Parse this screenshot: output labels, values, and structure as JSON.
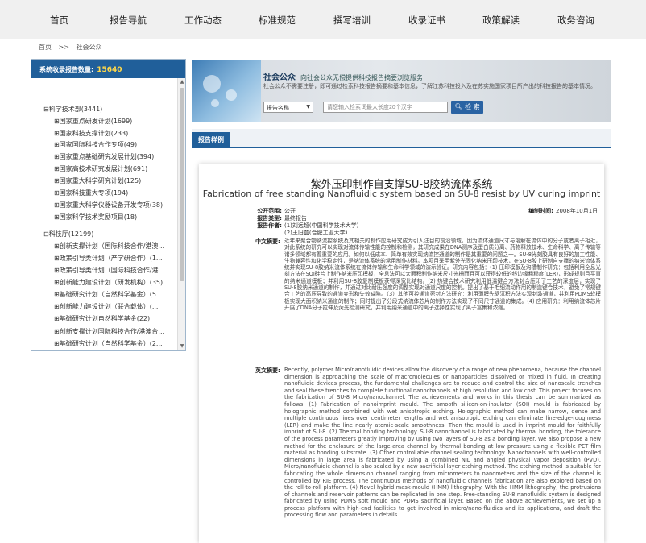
{
  "nav": [
    "首页",
    "报告导航",
    "工作动态",
    "标准规范",
    "撰写培训",
    "收录证书",
    "政策解读",
    "政务咨询"
  ],
  "breadcrumb": {
    "home": "首页",
    "sep": ">>",
    "current": "社会公众"
  },
  "sidebar": {
    "title": "系统收录报告数量:",
    "count": "15640",
    "tree": [
      {
        "pm": "⊟",
        "label": "科学技术部(3441)",
        "level": 0
      },
      {
        "pm": "⊞",
        "label": "国家重点研发计划(1699)",
        "level": 1
      },
      {
        "pm": "⊞",
        "label": "国家科技支撑计划(233)",
        "level": 1
      },
      {
        "pm": "⊞",
        "label": "国家国际科技合作专项(49)",
        "level": 1
      },
      {
        "pm": "⊞",
        "label": "国家重点基础研究发展计划(394)",
        "level": 1
      },
      {
        "pm": "⊞",
        "label": "国家高技术研究发展计划(691)",
        "level": 1
      },
      {
        "pm": "⊞",
        "label": "国家重大科学研究计划(125)",
        "level": 1
      },
      {
        "pm": "⊞",
        "label": "国家科技重大专项(194)",
        "level": 1
      },
      {
        "pm": "⊞",
        "label": "国家重大科学仪器设备开发专项(38)",
        "level": 1
      },
      {
        "pm": "⊞",
        "label": "国家科学技术奖励项目(18)",
        "level": 1
      },
      {
        "pm": "⊟",
        "label": "科技厅(12199)",
        "level": 0
      },
      {
        "pm": "⊞",
        "label": "创新支撑计划（国际科技合作/港澳...",
        "level": 1
      },
      {
        "pm": "⊞",
        "label": "政策引导类计划（产学研合作）(1...",
        "level": 1
      },
      {
        "pm": "⊞",
        "label": "政策引导类计划（国际科技合作/港...",
        "level": 1
      },
      {
        "pm": "⊞",
        "label": "创新能力建设计划（研发机构）(35)",
        "level": 1
      },
      {
        "pm": "⊞",
        "label": "基础研究计划（自然科学基金）(5...",
        "level": 1
      },
      {
        "pm": "⊞",
        "label": "创新能力建设计划（联合载体）(...",
        "level": 1
      },
      {
        "pm": "⊞",
        "label": "基础研究计划自然科学基金(22)",
        "level": 1
      },
      {
        "pm": "⊞",
        "label": "创新支撑计划国际科技合作/港澳台...",
        "level": 1
      },
      {
        "pm": "⊞",
        "label": "基础研究计划（自然科学基金）(2...",
        "level": 1
      }
    ]
  },
  "banner": {
    "title": "社会公众",
    "tag": "向社会公众无偿提供科技报告摘要浏览服务",
    "desc": "社会公众不需要注册，即可通过检索科技报告摘要和基本信息，了解江苏科技投入及在苏实施国家项目所产出的科技报告的基本情况。",
    "select_label": "报告名称",
    "search_placeholder": "请您输入检索词最大长度20个汉字",
    "search_button": "检 索"
  },
  "tab": {
    "label": "报告样例"
  },
  "report": {
    "zh_title": "紫外压印制作自支撑SU-8胶纳流体系统",
    "en_title": "Fabrication of free standing Nanofluidic system based on SU-8 resist by UV curing imprint",
    "meta": [
      {
        "key": "公开范围:",
        "value": "公开"
      },
      {
        "key": "报告类型:",
        "value": "最终报告"
      },
      {
        "key": "报告作者:",
        "value": "(1)刘远超(中国科学技术大学)"
      },
      {
        "key": "",
        "value": "(2)王旧盒(合肥工业大学)"
      }
    ],
    "date_key": "编制时间:",
    "date_value": "2008年10月1日",
    "zh_label": "中文摘要:",
    "zh_abstract": "近年来聚合物纳流控系统及其相关的制作应用研究成为引人注目的前沿领域。因为流体通道尺寸与溶解在流体中的分子或者离子相近，对此系统的研究可以实现对流体传输性能的控制和检测，其研究成果在DNA测序及蛋白质分离、药物释放技术、生命科学、离子传输等诸多领域都有着重要的应用。如何以低成本、简单有效实现纳流控通道的制作是其重要的问题之一。SU-8光刻胶具有良好的加工性能、生物兼容性和化学稳定性，是纳流体系统的常用制作材料。本项目采用紫外光固化纳米压印技术，在SU-8胶上研制自支撑的纳米流体系统并实现SU-8胶纳米流体系统在流体传输和生命科学领域的演示验证。研究内容包括：(1) 压印模板及沟槽制作研究：包括利用全息光刻方法在SOI硅片上制作纳米压印模板，全息法可以大面积制作纳米尺寸光栅而且可以获得较低的线边缘粗糙度(LER)，形成规则且平直的纳米通道模板；并利用SU-8胶复制模板获得深宽比结构。(2) 热键合技术研究利用低温键合方法封合压印了工艺的深度层，实现了SU-8胶纳米通道的制作，并通过对比耐压强度的调整实现对通道尺度的控制。提出了基于毛细流动作用的制造键合技术，避免了常规键合工艺的高压导致的通道变形和失效缺陷。（3）其他可控通道密封方法研究：利用薄膜先驱沉积方法实现封装通道，并利用PDMS软模板实现大面积纳米通道的制作；同时提出了分段式纳流体芯片的制作方法实现了不同尺寸通道的集成。(4) 应用研究：利用纳流体芯片开展了DNA分子拉伸及荧光检测研究，并利用纳米通道中的离子选择性实现了离子富集和浓缩。",
    "en_label": "英文摘要:",
    "en_abstract": "Recently, polymer Micro/nanofluidic devices allow the discovery of a range of new phenomena, because the channel dimension is approaching the scale of macromolecules or nanoparticles dissolved or mixed in fluid. In creating nanofluidic devices process, the fundamental challenges are to reduce and control the size of nanoscale trenches and seal these trenches to complete functional nanochannels at high resolution and low cost. This project focuses on the fabrication of SU-8 Micro/nanochannel. The achievements and works in this thesis can be summarized as follows: (1) Fabrication of nanoimprint mould. The smooth silicon-on-insulator (SOI) mould is fabricated by holographic method combined with wet anisotropic etching. Holographic method can make narrow, dense and multiple continuous lines over centimeter lengths and wet anisotropic etching can eliminate line-edge-roughness (LER) and make the line nearly atomic-scale smoothness. Then the mould is used in imprint mould for faithfully imprint of SU-8. (2) Thermal bonding technology. SU-8 nanochannel is fabricated by thermal bonding, the tolerance of the process parameters greatly improving by using two layers of SU-8 as a bonding layer. We also propose a new method for the enclosure of the large-area channel by thermal bonding at low pressure using a flexible PET film material as bonding substrate. (3) Other controllable channel sealing technology. Nanochannels with well-controlled dimensions in large area is fabricated by using a combined NIL and angled physical vapor deposition (PVD). Micro/nanofluidic channel is also sealed by a new sacrificial layer etching method. The etching method is suitable for fabricating the whole dimension channel ranging from micrometers to nanometers and the size of the channel is controlled by RIE process. The continuous methods of nanofluidic channels fabrication are also explored based on the roll-to-roll platform. (4) Novel hybrid mask-mould (HMM) lithography. With the HMM lithography, the protrusions of channels and reservoir patterns can be replicated in one step. Free-standing SU-8 nanofluidic system is designed fabricated by using PDMS soft mould and PDMS sacrificial layer. Based on the above achievements, we set up a process platform with high-end facilities to get involved in micro/nano-fluidics and its applications, and draft the processing flow and parameters in details."
  },
  "colors": {
    "header_blue": "#205f9a",
    "count_yellow": "#ffd84a",
    "button_blue": "#2a63a3"
  }
}
